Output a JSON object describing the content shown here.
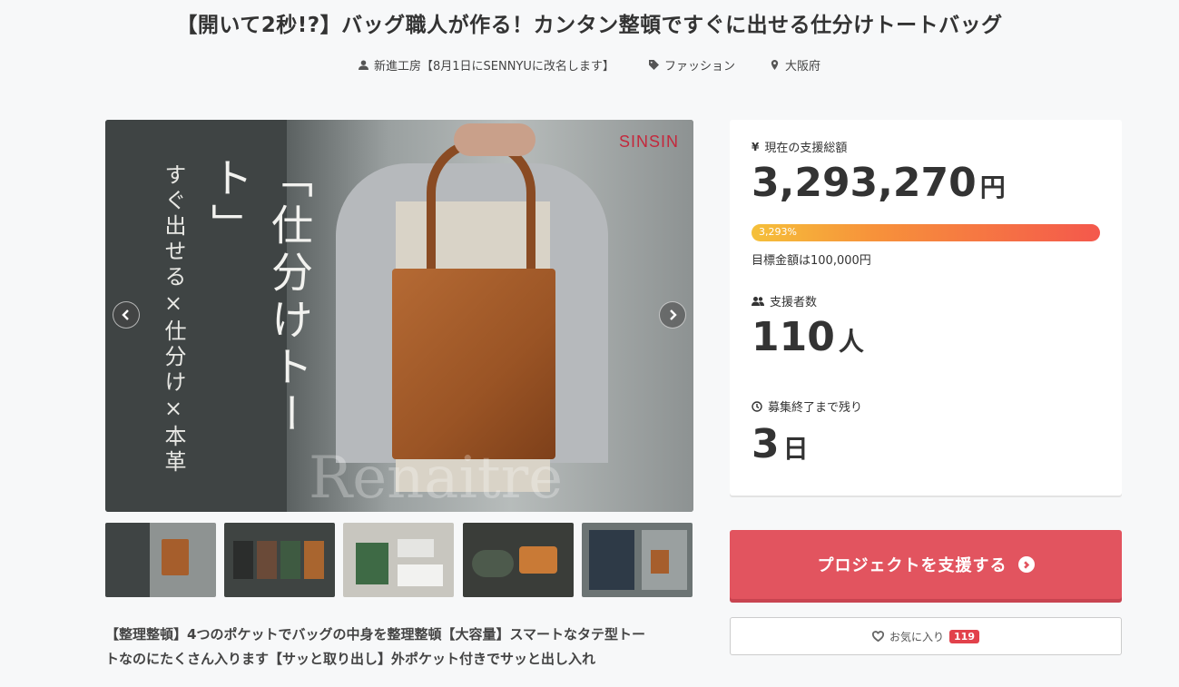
{
  "project": {
    "title": "【開いて2秒!?】バッグ職人が作る！カンタン整頓ですぐに出せる仕分けトートバッグ",
    "owner": "新進工房【8月1日にSENNYUに改名します】",
    "category": "ファッション",
    "location": "大阪府",
    "description_line1": "【整理整頓】4つのポケットでバッグの中身を整理整頓【大容量】スマートなタテ型トー",
    "description_line2": "トなのにたくさん入ります【サッと取り出し】外ポケット付きでサッと出し入れ"
  },
  "hero": {
    "vertical_main": "「仕分けトート」",
    "vertical_sub": "すぐ出せる×仕分け×本革",
    "brand": "SINSIN",
    "watermark": "Renaitre"
  },
  "thumbnails": [
    {
      "label": "仕分けトート",
      "color": "#555a59"
    },
    {
      "label": "color variations",
      "color": "#3f4442"
    },
    {
      "label": "contents",
      "color": "#bfbdb6"
    },
    {
      "label": "inside pocket",
      "color": "#3a3d39"
    },
    {
      "label": "lifestyle",
      "color": "#5c6463"
    }
  ],
  "stats": {
    "total_label": "現在の支援総額",
    "total_value": "3,293,270",
    "total_unit": "円",
    "percent_text": "3,293%",
    "progress_fraction": 1.0,
    "goal_text": "目標金額は100,000円",
    "backers_label": "支援者数",
    "backers_value": "110",
    "backers_unit": "人",
    "remaining_label": "募集終了まで残り",
    "remaining_value": "3",
    "remaining_unit": "日"
  },
  "actions": {
    "support_label": "プロジェクトを支援する",
    "favorite_label": "お気に入り",
    "favorite_count": "119"
  },
  "colors": {
    "accent": "#e2545f",
    "badge": "#e2414b",
    "brand": "#c4283c"
  },
  "icons": {
    "owner": "user-icon",
    "category": "tag-icon",
    "location": "map-pin-icon",
    "total": "yen-icon",
    "backers": "users-icon",
    "remaining": "clock-icon",
    "favorite": "heart-icon"
  }
}
